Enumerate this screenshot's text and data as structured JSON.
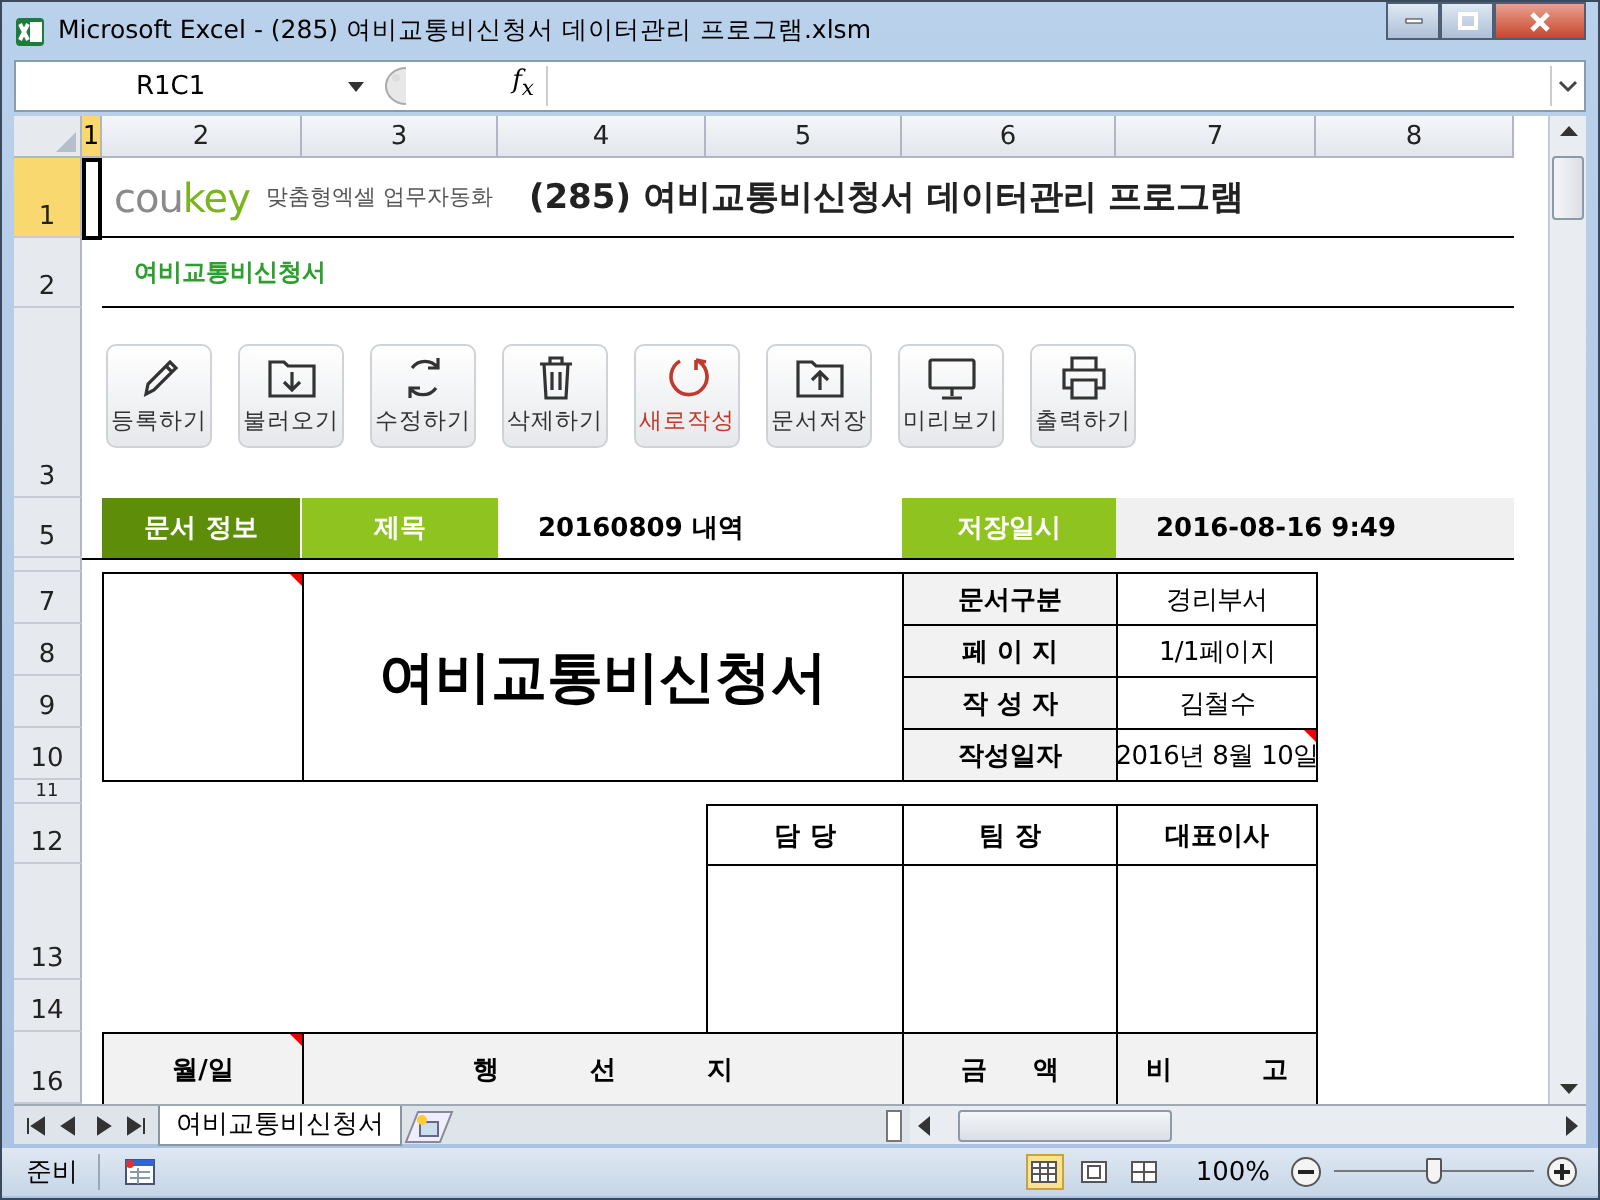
{
  "window": {
    "title": "Microsoft Excel - (285) 여비교통비신청서 데이터관리 프로그램.xlsm"
  },
  "formula_bar": {
    "name_box": "R1C1",
    "function_label": "f$_{x}$"
  },
  "column_headers": [
    {
      "label": "1",
      "selected": true
    },
    {
      "label": "2",
      "selected": false
    },
    {
      "label": "3",
      "selected": false
    },
    {
      "label": "4",
      "selected": false
    },
    {
      "label": "5",
      "selected": false
    },
    {
      "label": "6",
      "selected": false
    },
    {
      "label": "7",
      "selected": false
    },
    {
      "label": "8",
      "selected": false
    }
  ],
  "row_headers": [
    {
      "label": "1",
      "selected": true
    },
    {
      "label": "2",
      "selected": false
    },
    {
      "label": "3",
      "selected": false
    },
    {
      "label": "5",
      "selected": false
    },
    {
      "label": "7",
      "selected": false
    },
    {
      "label": "8",
      "selected": false
    },
    {
      "label": "9",
      "selected": false
    },
    {
      "label": "10",
      "selected": false
    },
    {
      "label": "11",
      "selected": false
    },
    {
      "label": "12",
      "selected": false
    },
    {
      "label": "13",
      "selected": false
    },
    {
      "label": "14",
      "selected": false
    },
    {
      "label": "16",
      "selected": false
    }
  ],
  "header": {
    "logo_grey": "cou",
    "logo_green": "key",
    "tagline": "맞춤형엑셀 업무자동화",
    "title": "(285) 여비교통비신청서 데이터관리 프로그램",
    "subtitle": "여비교통비신청서"
  },
  "buttons": [
    {
      "label": "등록하기",
      "color": "#333333"
    },
    {
      "label": "불러오기",
      "color": "#333333"
    },
    {
      "label": "수정하기",
      "color": "#333333"
    },
    {
      "label": "삭제하기",
      "color": "#333333"
    },
    {
      "label": "새로작성",
      "color": "#c0392b"
    },
    {
      "label": "문서저장",
      "color": "#333333"
    },
    {
      "label": "미리보기",
      "color": "#333333"
    },
    {
      "label": "출력하기",
      "color": "#333333"
    }
  ],
  "doc_info": {
    "section": "문서 정보",
    "title_label": "제목",
    "title_value": "20160809 내역",
    "saved_label": "저장일시",
    "saved_value": "2016-08-16 9:49"
  },
  "form": {
    "logo_comment": true,
    "title": "여비교통비신청서",
    "meta": [
      {
        "label": "문서구분",
        "value": "경리부서",
        "comment": false
      },
      {
        "label": "페 이 지",
        "value": "1/1페이지",
        "comment": false
      },
      {
        "label": "작 성 자",
        "value": "김철수",
        "comment": false
      },
      {
        "label": "작성일자",
        "value": "2016년 8월 10일",
        "comment": true
      }
    ],
    "approvals": [
      "담 당",
      "팀 장",
      "대표이사"
    ],
    "columns": [
      {
        "label": "월/일",
        "comment": true
      },
      {
        "label": "행          선          지",
        "comment": false
      },
      {
        "label": "금     액",
        "comment": false
      },
      {
        "label": "비          고",
        "comment": false
      }
    ]
  },
  "sheet_tabs": [
    {
      "label": "여비교통비신청서",
      "selected": true
    }
  ],
  "status_bar": {
    "status": "준비",
    "zoom": "100%",
    "views": [
      {
        "selected": true
      },
      {
        "selected": false
      },
      {
        "selected": false
      }
    ],
    "zoom_slider": {
      "level": 0.5
    }
  }
}
